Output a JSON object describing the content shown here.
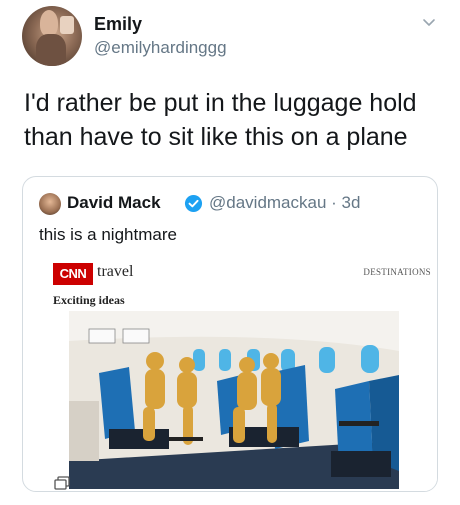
{
  "tweet": {
    "author_name": "Emily",
    "author_handle": "@emilyhardinggg",
    "text_line1": "I'd rather be put in the luggage hold",
    "text_line2": "than have to sit like this on a plane"
  },
  "quoted": {
    "name": "David Mack",
    "handle_meta": "@davidmackau · 3d",
    "text": "this is a nightmare",
    "article": {
      "logo": "CNN",
      "section": "travel",
      "tag": "DESTINATIONS",
      "subtitle": "Exciting ideas"
    }
  },
  "colors": {
    "verified": "#1da1f2",
    "cnn_red": "#cc0000",
    "seat_blue": "#1e6fb4",
    "mannequin": "#d9a33c"
  },
  "icons": {
    "menu": "chevron-down-icon",
    "badge": "verified-icon",
    "media": "gallery-icon"
  }
}
